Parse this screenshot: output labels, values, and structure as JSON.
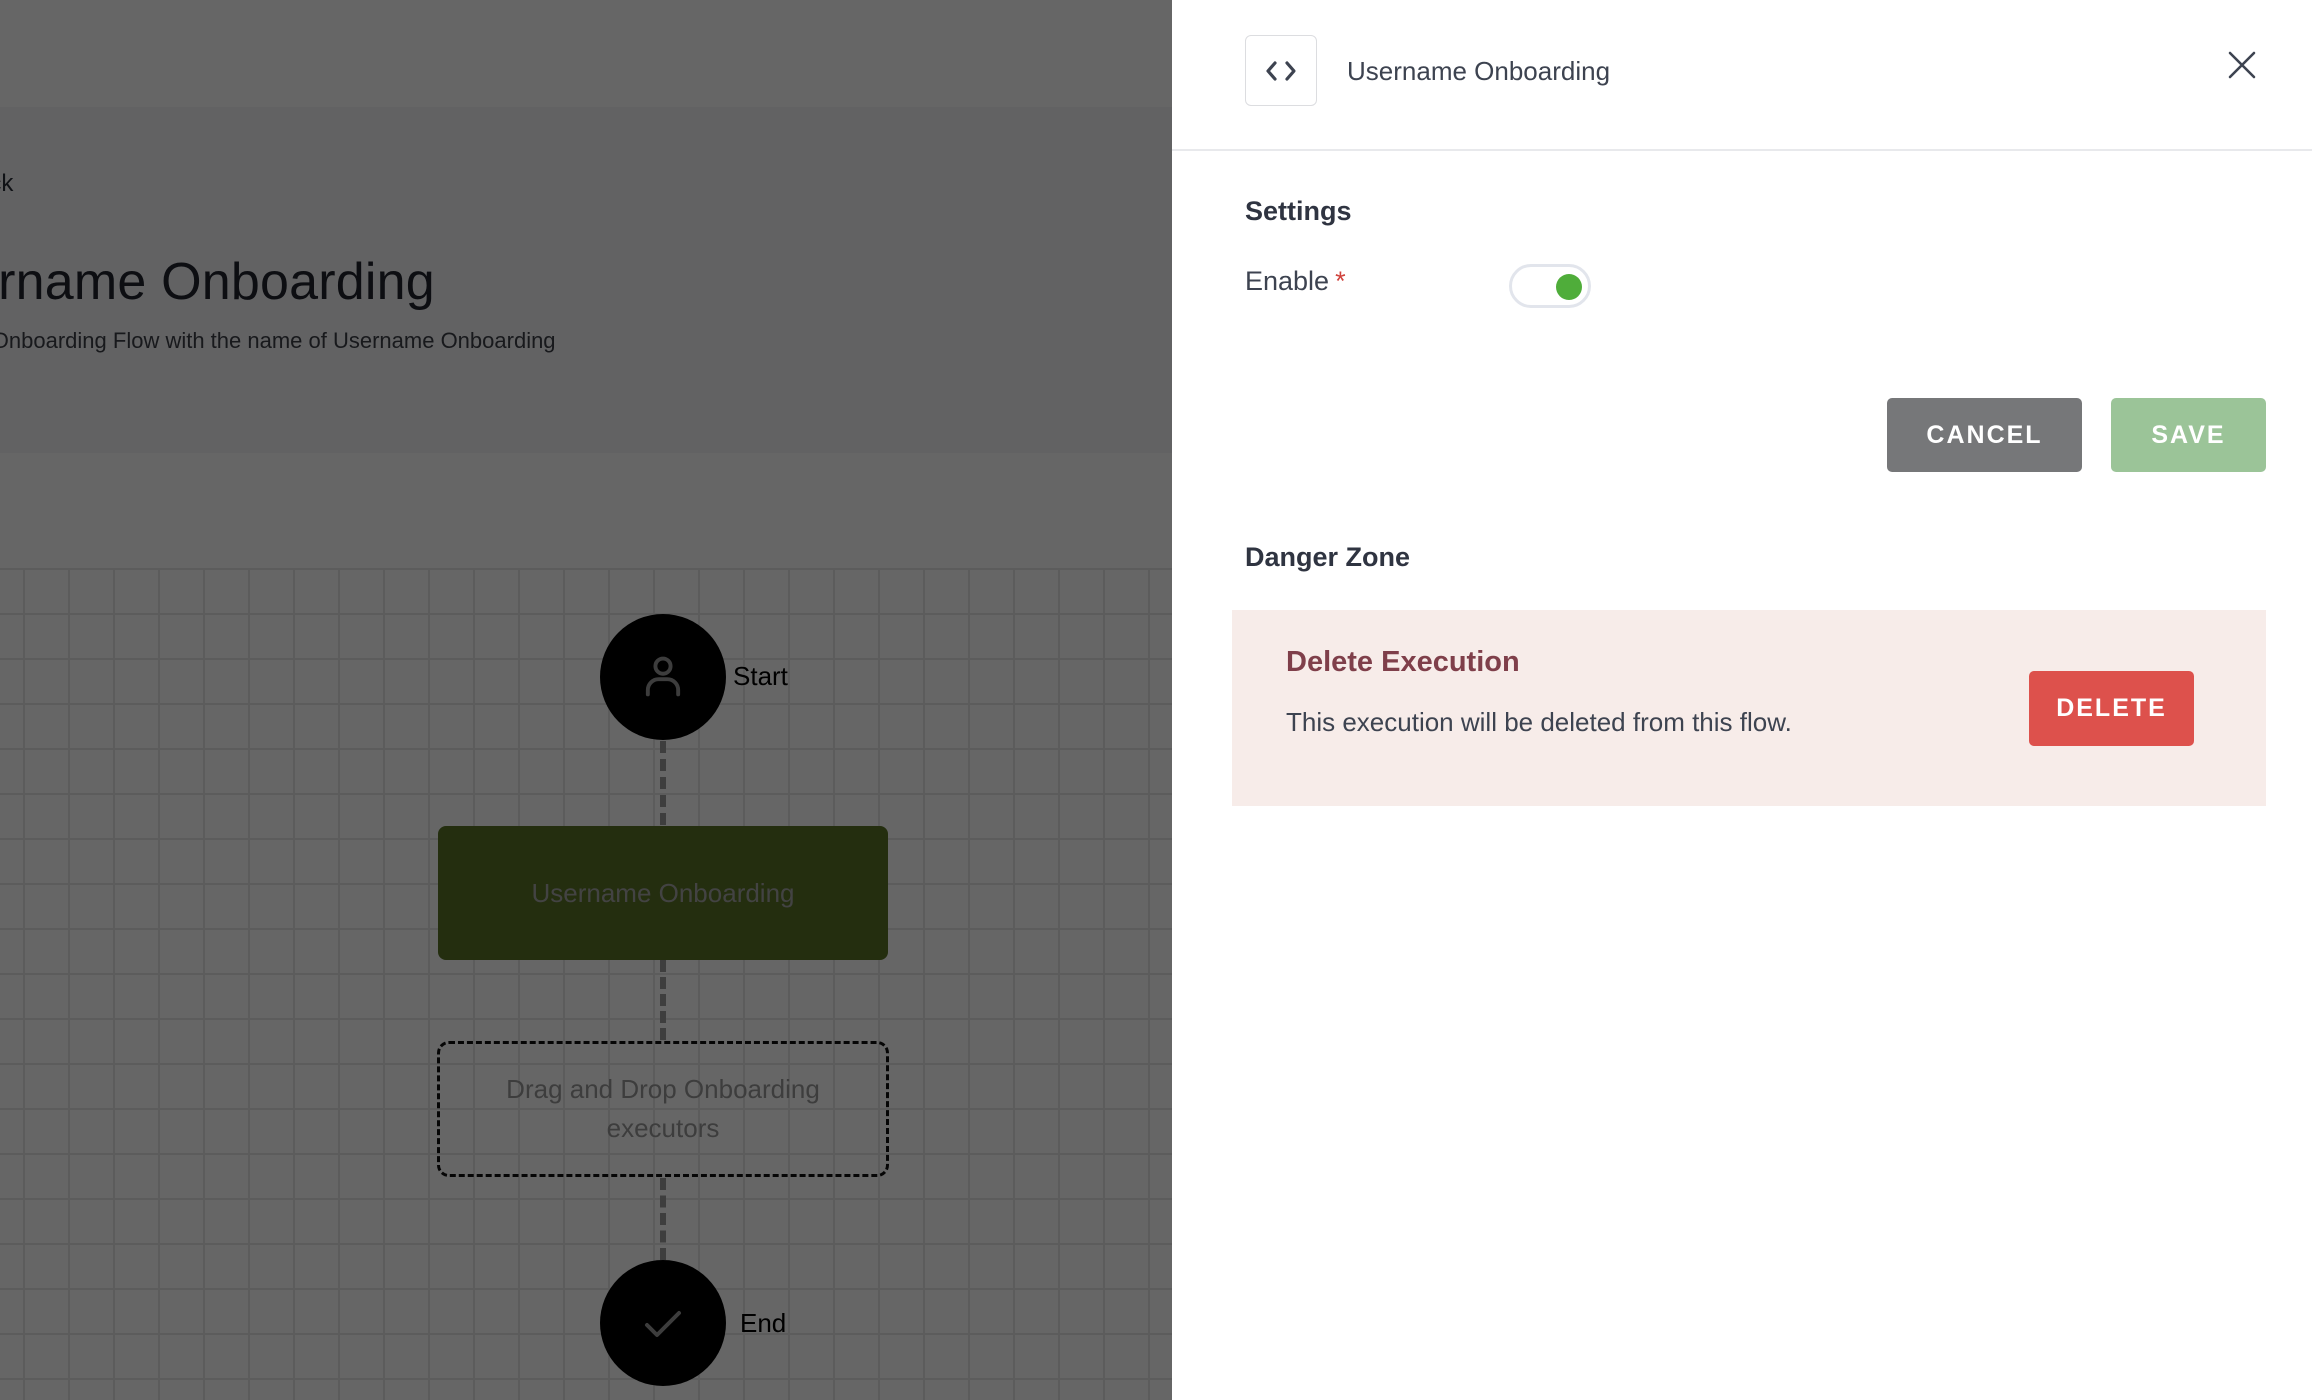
{
  "background_page": {
    "back_link": "Back",
    "title": "Username Onboarding",
    "subtitle": "CustomOnboarding Flow with the name of Username Onboarding",
    "flow": {
      "start_label": "Start",
      "end_label": "End",
      "step_node": "Username Onboarding",
      "drop_zone": "Drag and Drop Onboarding executors",
      "step_color": "#5a7327"
    }
  },
  "panel": {
    "title": "Username Onboarding",
    "header_icon": "code-icon",
    "close_icon": "close-icon",
    "settings": {
      "title": "Settings",
      "enable_label": "Enable",
      "required_marker": "*",
      "enabled": true
    },
    "actions": {
      "cancel_label": "CANCEL",
      "save_label": "SAVE"
    },
    "danger_zone": {
      "title": "Danger Zone",
      "heading": "Delete Execution",
      "description": "This execution will be deleted from this flow.",
      "delete_label": "DELETE"
    }
  },
  "colors": {
    "toggle_on": "#4fad3a",
    "cancel": "#767779",
    "save": "#9bc498",
    "delete": "#dd514c",
    "danger_bg": "#f7ece9",
    "danger_heading": "#7f3f4a"
  }
}
